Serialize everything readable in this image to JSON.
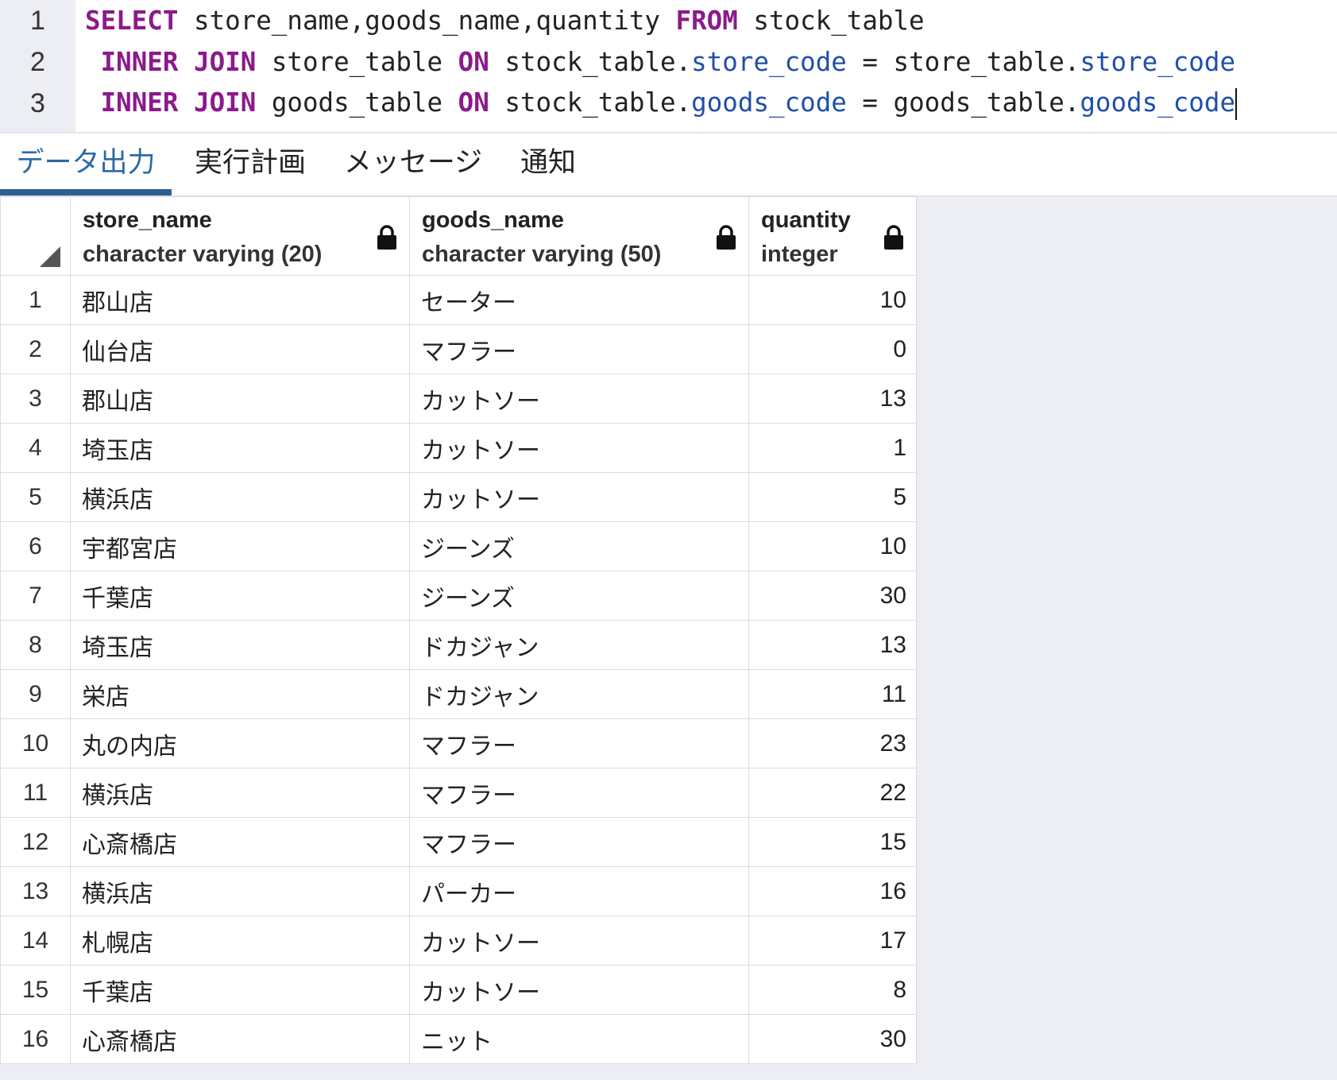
{
  "editor": {
    "lines": [
      {
        "num": "1",
        "tokens": [
          {
            "t": "SELECT",
            "c": "kw"
          },
          {
            "t": " store_name,goods_name,quantity ",
            "c": ""
          },
          {
            "t": "FROM",
            "c": "kw"
          },
          {
            "t": " stock_table",
            "c": ""
          }
        ]
      },
      {
        "num": "2",
        "tokens": [
          {
            "t": " ",
            "c": ""
          },
          {
            "t": "INNER",
            "c": "kw"
          },
          {
            "t": " ",
            "c": ""
          },
          {
            "t": "JOIN",
            "c": "kw"
          },
          {
            "t": " store_table ",
            "c": ""
          },
          {
            "t": "ON",
            "c": "kw"
          },
          {
            "t": " stock_table.",
            "c": ""
          },
          {
            "t": "store_code",
            "c": "prop"
          },
          {
            "t": " = store_table.",
            "c": ""
          },
          {
            "t": "store_code",
            "c": "prop"
          }
        ]
      },
      {
        "num": "3",
        "tokens": [
          {
            "t": " ",
            "c": ""
          },
          {
            "t": "INNER",
            "c": "kw"
          },
          {
            "t": " ",
            "c": ""
          },
          {
            "t": "JOIN",
            "c": "kw"
          },
          {
            "t": " goods_table ",
            "c": ""
          },
          {
            "t": "ON",
            "c": "kw"
          },
          {
            "t": " stock_table.",
            "c": ""
          },
          {
            "t": "goods_code",
            "c": "prop"
          },
          {
            "t": " = goods_table.",
            "c": ""
          },
          {
            "t": "goods_code",
            "c": "prop"
          }
        ]
      }
    ]
  },
  "tabs": [
    {
      "label": "データ出力",
      "active": true
    },
    {
      "label": "実行計画",
      "active": false
    },
    {
      "label": "メッセージ",
      "active": false
    },
    {
      "label": "通知",
      "active": false
    }
  ],
  "grid": {
    "columns": [
      {
        "name": "store_name",
        "type": "character varying (20)",
        "locked": true
      },
      {
        "name": "goods_name",
        "type": "character varying (50)",
        "locked": true
      },
      {
        "name": "quantity",
        "type": "integer",
        "locked": true
      }
    ],
    "rows": [
      {
        "n": "1",
        "store": "郡山店",
        "goods": "セーター",
        "qty": "10"
      },
      {
        "n": "2",
        "store": "仙台店",
        "goods": "マフラー",
        "qty": "0"
      },
      {
        "n": "3",
        "store": "郡山店",
        "goods": "カットソー",
        "qty": "13"
      },
      {
        "n": "4",
        "store": "埼玉店",
        "goods": "カットソー",
        "qty": "1"
      },
      {
        "n": "5",
        "store": "横浜店",
        "goods": "カットソー",
        "qty": "5"
      },
      {
        "n": "6",
        "store": "宇都宮店",
        "goods": "ジーンズ",
        "qty": "10"
      },
      {
        "n": "7",
        "store": "千葉店",
        "goods": "ジーンズ",
        "qty": "30"
      },
      {
        "n": "8",
        "store": "埼玉店",
        "goods": "ドカジャン",
        "qty": "13"
      },
      {
        "n": "9",
        "store": "栄店",
        "goods": "ドカジャン",
        "qty": "11"
      },
      {
        "n": "10",
        "store": "丸の内店",
        "goods": "マフラー",
        "qty": "23"
      },
      {
        "n": "11",
        "store": "横浜店",
        "goods": "マフラー",
        "qty": "22"
      },
      {
        "n": "12",
        "store": "心斎橋店",
        "goods": "マフラー",
        "qty": "15"
      },
      {
        "n": "13",
        "store": "横浜店",
        "goods": "パーカー",
        "qty": "16"
      },
      {
        "n": "14",
        "store": "札幌店",
        "goods": "カットソー",
        "qty": "17"
      },
      {
        "n": "15",
        "store": "千葉店",
        "goods": "カットソー",
        "qty": "8"
      },
      {
        "n": "16",
        "store": "心斎橋店",
        "goods": "ニット",
        "qty": "30"
      }
    ]
  },
  "colors": {
    "keyword": "#8b1a8b",
    "property": "#1f4fa8",
    "active_tab": "#2b6aa6",
    "tab_underline": "#2b5f8f",
    "gutter_bg": "#eceef3"
  },
  "icons": {
    "column_lock": "lock-icon",
    "select_all": "select-all-corner-icon"
  }
}
